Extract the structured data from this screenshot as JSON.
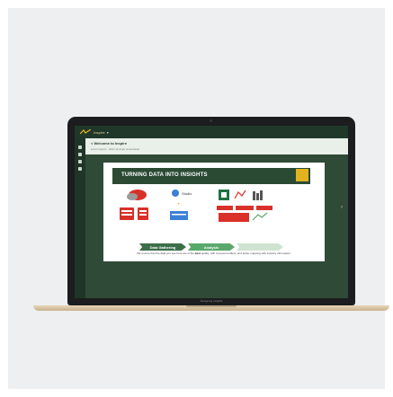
{
  "app": {
    "name": "Inspire",
    "chevron": "▾",
    "breadcrumb": "< Welcome to Inspire",
    "breadcrumb_sub": "Lorem ipsum · dolor sit amet consectetur",
    "bottom_label": "Designing Insights"
  },
  "slide": {
    "title": "TURNING DATA INTO INSIGHTS",
    "studio_label": "Studio",
    "steps": [
      "Data Gathering",
      "Analysis",
      "Insights"
    ],
    "caption_pre": "We ensure that the data you see here are of the ",
    "caption_bold": "best",
    "caption_post": " quality, with removed outliers, and better mapping with industry information."
  },
  "colors": {
    "dark_green": "#2c4432",
    "header_green": "#2a4a34",
    "accent_yellow": "#e3b31f",
    "accent_red": "#d9302a",
    "excel_green": "#1f7244"
  }
}
